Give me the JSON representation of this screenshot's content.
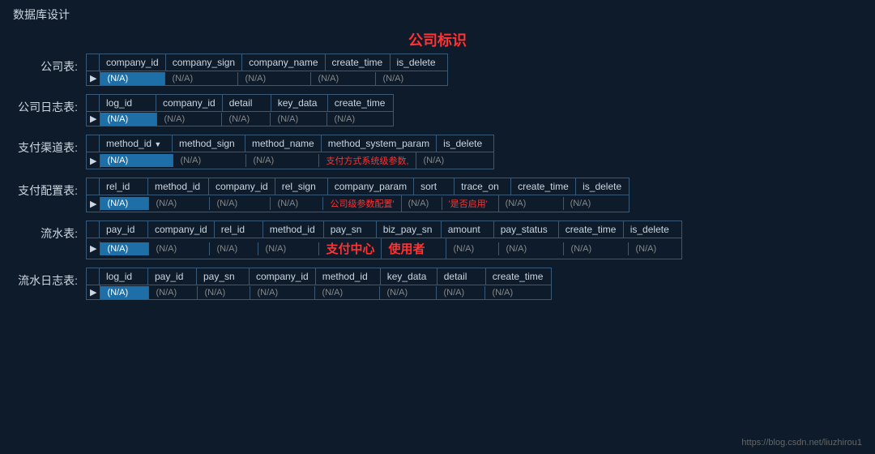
{
  "page": {
    "title": "数据库设计",
    "company_label": "公司标识",
    "footer_url": "https://blog.csdn.net/liuzhirou1"
  },
  "tables": [
    {
      "label": "公司表:",
      "columns": [
        "company_id",
        "company_sign",
        "company_name",
        "create_time",
        "is_delete"
      ],
      "widths": [
        80,
        90,
        90,
        80,
        70
      ],
      "rows": [
        [
          "highlight-blue",
          "normal",
          "normal",
          "normal",
          "normal"
        ]
      ],
      "row_values": [
        "(N/A)",
        "(N/A)",
        "(N/A)",
        "(N/A)",
        "(N/A)"
      ],
      "special": null
    },
    {
      "label": "公司日志表:",
      "columns": [
        "log_id",
        "company_id",
        "detail",
        "key_data",
        "create_time"
      ],
      "widths": [
        70,
        80,
        60,
        70,
        80
      ],
      "rows": [
        [
          "highlight-blue",
          "normal",
          "normal",
          "normal",
          "normal"
        ]
      ],
      "row_values": [
        "(N/A)",
        "(N/A)",
        "(N/A)",
        "(N/A)",
        "(N/A)"
      ],
      "special": null
    },
    {
      "label": "支付渠道表:",
      "columns": [
        "method_id ▼",
        "method_sign",
        "method_name",
        "method_system_param",
        "is_delete"
      ],
      "widths": [
        90,
        90,
        90,
        120,
        70
      ],
      "rows": [
        [
          "highlight-blue",
          "normal",
          "normal",
          "red-text",
          "normal"
        ]
      ],
      "row_values": [
        "(N/A)",
        "(N/A)",
        "(N/A)",
        "支付方式系统级参数,",
        "(N/A)"
      ],
      "special": null
    },
    {
      "label": "支付配置表:",
      "columns": [
        "rel_id",
        "method_id",
        "company_id",
        "rel_sign",
        "company_param",
        "sort",
        "trace_on",
        "create_time",
        "is_delete"
      ],
      "widths": [
        60,
        75,
        75,
        65,
        90,
        50,
        70,
        80,
        65
      ],
      "rows": [
        [
          "highlight-blue",
          "normal",
          "normal",
          "normal",
          "red-text",
          "normal",
          "red-text",
          "normal",
          "normal"
        ]
      ],
      "row_values": [
        "(N/A)",
        "(N/A)",
        "(N/A)",
        "(N/A)",
        "公司级参数配置'",
        "(N/A)",
        "'是否启用'",
        "(N/A)",
        "(N/A)"
      ],
      "special": null
    },
    {
      "label": "流水表:",
      "columns": [
        "pay_id",
        "company_id",
        "rel_id",
        "method_id",
        "pay_sn",
        "biz_pay_sn",
        "amount",
        "pay_status",
        "create_time",
        "is_delete"
      ],
      "widths": [
        60,
        75,
        60,
        75,
        65,
        80,
        65,
        80,
        80,
        65
      ],
      "rows": [
        [
          "highlight-blue",
          "normal",
          "normal",
          "normal",
          "red-bold-center",
          "red-bold-center",
          "normal",
          "normal",
          "normal",
          "normal"
        ]
      ],
      "row_values": [
        "(N/A)",
        "(N/A)",
        "(N/A)",
        "(N/A)",
        "支付中心",
        "使用者",
        "(N/A)",
        "(N/A)",
        "(N/A)",
        "(N/A)"
      ],
      "special": "payment-center"
    },
    {
      "label": "流水日志表:",
      "columns": [
        "log_id",
        "pay_id",
        "pay_sn",
        "company_id",
        "method_id",
        "key_data",
        "detail",
        "create_time"
      ],
      "widths": [
        60,
        60,
        65,
        80,
        80,
        70,
        60,
        80
      ],
      "rows": [
        [
          "highlight-blue",
          "normal",
          "normal",
          "normal",
          "normal",
          "normal",
          "normal",
          "normal"
        ]
      ],
      "row_values": [
        "(N/A)",
        "(N/A)",
        "(N/A)",
        "(N/A)",
        "(N/A)",
        "(N/A)",
        "(N/A)",
        "(N/A)"
      ],
      "special": null
    }
  ]
}
